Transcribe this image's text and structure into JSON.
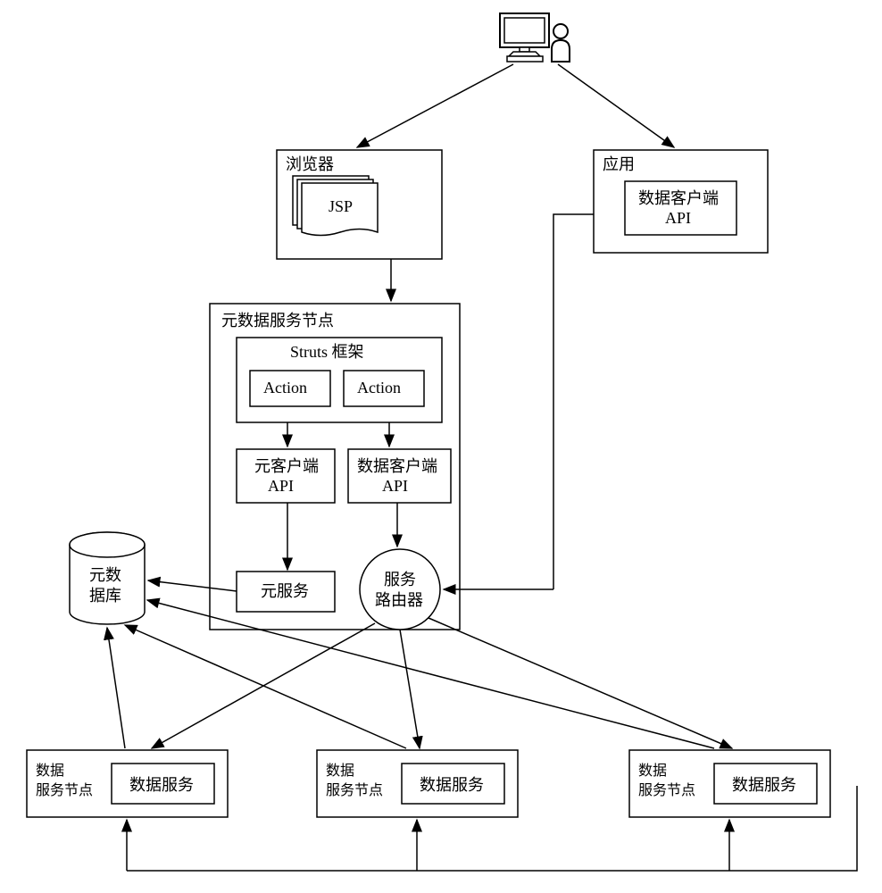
{
  "user": {
    "icon": "computer-user-icon"
  },
  "browser": {
    "title": "浏览器",
    "jsp": "JSP"
  },
  "app": {
    "title": "应用",
    "client_api_line1": "数据客户端",
    "client_api_line2": "API"
  },
  "metadata_node": {
    "title": "元数据服务节点",
    "struts": "Struts 框架",
    "action1": "Action",
    "action2": "Action",
    "meta_client_line1": "元客户端",
    "meta_client_line2": "API",
    "data_client_line1": "数据客户端",
    "data_client_line2": "API",
    "meta_service": "元服务",
    "router_line1": "服务",
    "router_line2": "路由器"
  },
  "metadata_db": {
    "line1": "元数",
    "line2": "据库"
  },
  "data_nodes": [
    {
      "title_line1": "数据",
      "title_line2": "服务节点",
      "service": "数据服务"
    },
    {
      "title_line1": "数据",
      "title_line2": "服务节点",
      "service": "数据服务"
    },
    {
      "title_line1": "数据",
      "title_line2": "服务节点",
      "service": "数据服务"
    }
  ]
}
